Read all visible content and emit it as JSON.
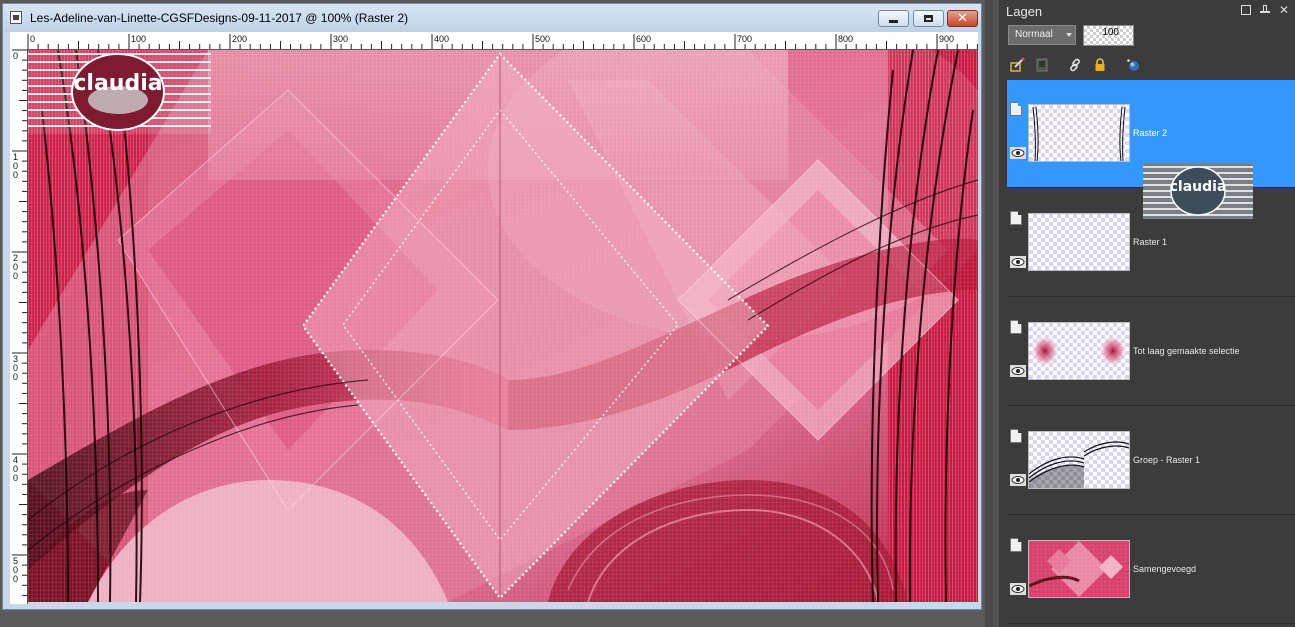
{
  "document": {
    "title": "Les-Adeline-van-Linette-CGSFDesigns-09-11-2017 @ 100% (Raster 2)",
    "window_buttons": {
      "minimize": "minimize-icon",
      "maximize": "maximize-icon",
      "close": "close-icon"
    },
    "hruler_labels": [
      "0",
      "100",
      "200",
      "300",
      "400",
      "500",
      "600",
      "700",
      "800",
      "900"
    ],
    "vruler_labels": [
      "0",
      "100",
      "200",
      "300",
      "400",
      "500"
    ],
    "watermark_text": "claudia"
  },
  "layers_panel": {
    "title": "Lagen",
    "blend_mode": "Normaal",
    "opacity": "100",
    "layers": [
      {
        "name": "Raster 2",
        "selected": true,
        "thumb": "raster2"
      },
      {
        "name": "Raster 1",
        "selected": false,
        "thumb": "empty"
      },
      {
        "name": "Tot laag gemaakte selectie",
        "selected": false,
        "thumb": "selection"
      },
      {
        "name": "Groep - Raster 1",
        "selected": false,
        "thumb": "group"
      },
      {
        "name": "Samengevoegd",
        "selected": false,
        "thumb": "merged"
      }
    ],
    "drag_ghost_text": "claudia"
  },
  "colors": {
    "selection_blue": "#3399ff",
    "canvas_pink": "#d83f6c",
    "canvas_dark_red": "#7a0f22"
  }
}
